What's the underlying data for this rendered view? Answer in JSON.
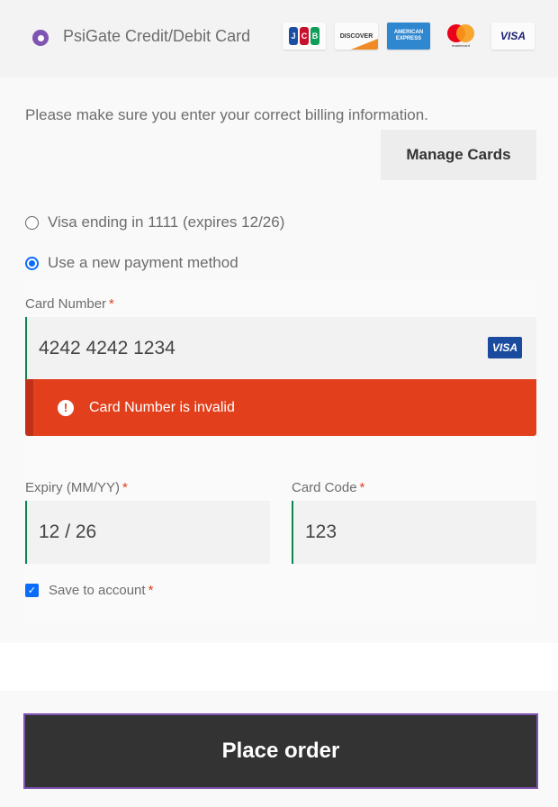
{
  "gateway": {
    "label": "PsiGate Credit/Debit Card",
    "selected": true,
    "accent_color": "#7f54b3",
    "card_logos": [
      {
        "name": "jcb",
        "text": "JCB"
      },
      {
        "name": "discover",
        "text": "DISCOVER"
      },
      {
        "name": "amex",
        "text": "AMERICAN EXPRESS"
      },
      {
        "name": "mastercard",
        "text": "mastercard"
      },
      {
        "name": "visa",
        "text": "VISA"
      }
    ]
  },
  "notice": "Please make sure you enter your correct billing information.",
  "manage_cards_label": "Manage Cards",
  "payment_options": [
    {
      "label": "Visa ending in 1111 (expires 12/26)",
      "selected": false
    },
    {
      "label": "Use a new payment method",
      "selected": true
    }
  ],
  "card_number": {
    "label": "Card Number",
    "required_mark": "*",
    "value": "4242 4242 1234",
    "brand_badge": "VISA"
  },
  "error": {
    "icon": "!",
    "message": "Card Number is invalid",
    "color": "#e2401c"
  },
  "expiry": {
    "label": "Expiry (MM/YY)",
    "required_mark": "*",
    "value": "12 / 26"
  },
  "card_code": {
    "label": "Card Code",
    "required_mark": "*",
    "value": "123"
  },
  "save_to_account": {
    "label": "Save to account",
    "required_mark": "*",
    "checked": true,
    "check_glyph": "✓"
  },
  "place_order_label": "Place order"
}
